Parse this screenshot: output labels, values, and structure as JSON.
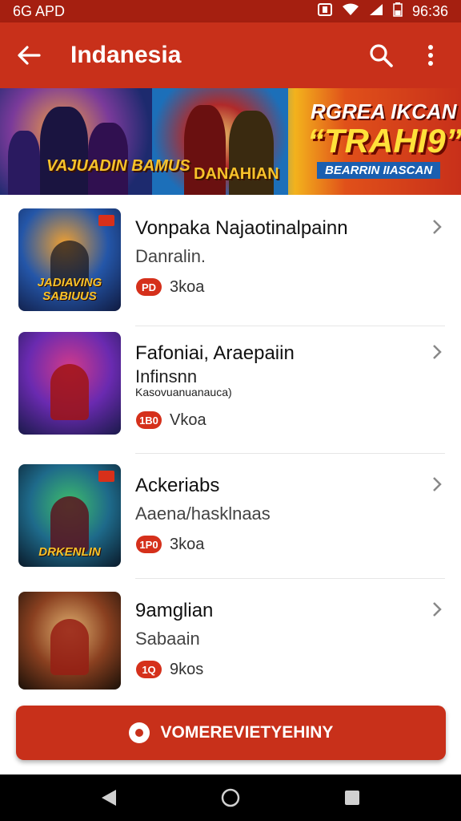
{
  "status_bar": {
    "carrier": "6G APD",
    "time": "96:36",
    "icons": [
      "nfc-icon",
      "wifi-icon",
      "signal-icon",
      "battery-icon"
    ]
  },
  "app_bar": {
    "title": "Indanesia",
    "back_icon": "arrow-left-icon",
    "search_icon": "search-icon",
    "menu_icon": "more-vert-icon"
  },
  "banner": {
    "art1_text": "VAJUADIN BAMUS",
    "art2_text": "DANAHIAN",
    "promo_title": "RGREA IKCAN",
    "promo_main": "“TRAHI9”",
    "promo_sub": "BEARRIN IIASCAN"
  },
  "items": [
    {
      "title": "Vonpaka Najaotinalpainn",
      "subtitle": "Danralin.",
      "extra": "",
      "badge": "PD",
      "badge_value": "3koa",
      "thumb_caption": "JADIAVING SABIUUS",
      "colors": [
        "#f0a030",
        "#2456a8",
        "#101a40"
      ]
    },
    {
      "title": "Fafoniai, Araepaiin",
      "subtitle": "Infinsnn",
      "extra": "Kasovuanuanauca)",
      "badge": "1B0",
      "badge_value": "Vkoa",
      "thumb_caption": "",
      "colors": [
        "#d23a8a",
        "#6a2ab0",
        "#1a1a4a"
      ]
    },
    {
      "title": "Ackeriabs",
      "subtitle": "Aaena/hasklnaas",
      "extra": "",
      "badge": "1P0",
      "badge_value": "3koa",
      "thumb_caption": "DRKENLIN",
      "colors": [
        "#3fbf6a",
        "#1e6a8a",
        "#0a1a2a"
      ]
    },
    {
      "title": "9amglian",
      "subtitle": "Sabaain",
      "extra": "",
      "badge": "1Q",
      "badge_value": "9kos",
      "thumb_caption": "",
      "colors": [
        "#e0b070",
        "#8a4020",
        "#1a1008"
      ]
    }
  ],
  "cta": {
    "label": "VOMEREVIETYEHINY"
  },
  "nav_bar": {
    "icons": [
      "back-triangle-icon",
      "home-circle-icon",
      "recents-square-icon"
    ]
  }
}
